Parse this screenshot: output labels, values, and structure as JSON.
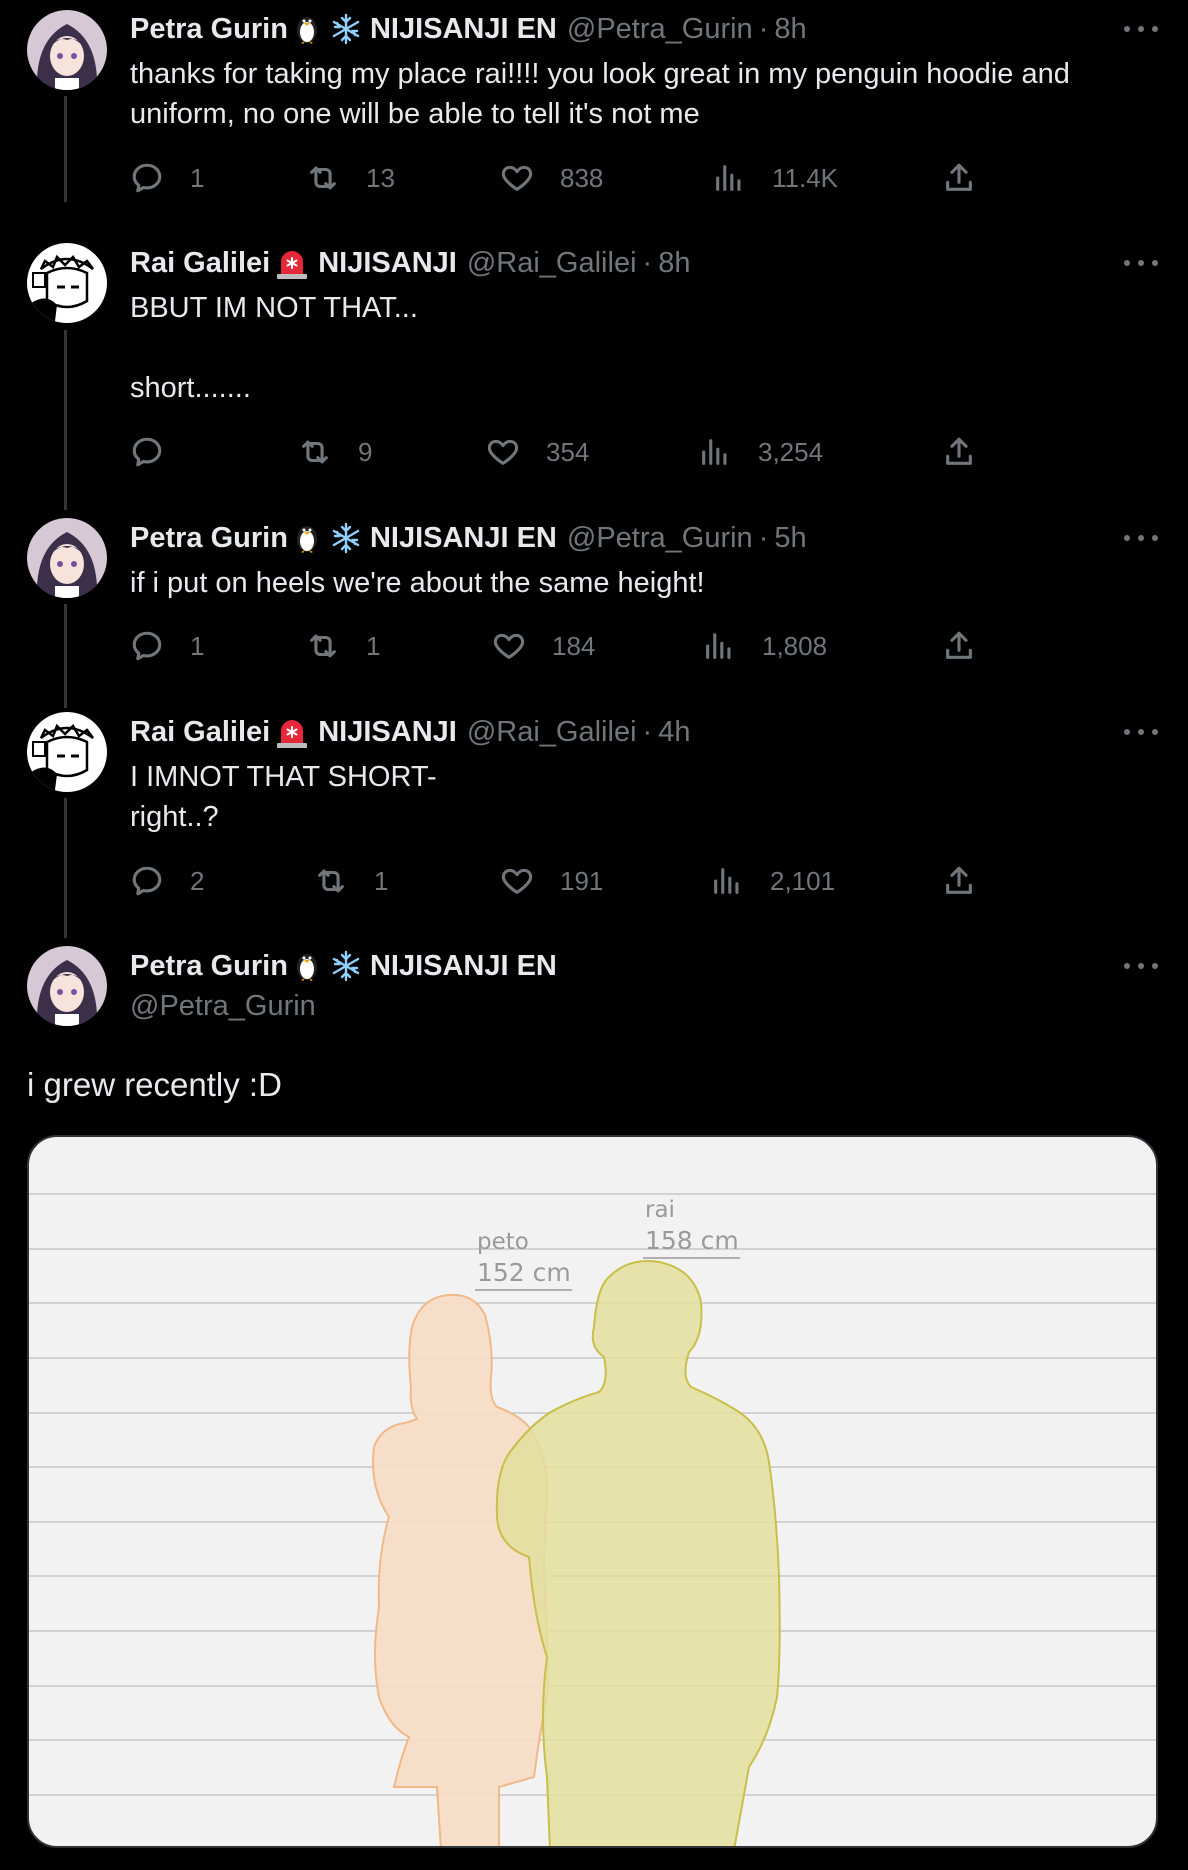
{
  "tweets": [
    {
      "name": "Petra Gurin",
      "org": "NIJISANJI EN",
      "handle": "@Petra_Gurin",
      "time": "8h",
      "text": "thanks for taking my place rai!!!! you look great in my penguin hoodie and\nuniform, no one will be able to tell it's not me",
      "replies": "1",
      "retweets": "13",
      "likes": "838",
      "views": "11.4K"
    },
    {
      "name": "Rai Galilei",
      "org": "NIJISANJI",
      "handle": "@Rai_Galilei",
      "time": "8h",
      "text": "BBUT IM NOT THAT...\n\nshort.......",
      "replies": "",
      "retweets": "9",
      "likes": "354",
      "views": "3,254"
    },
    {
      "name": "Petra Gurin",
      "org": "NIJISANJI EN",
      "handle": "@Petra_Gurin",
      "time": "5h",
      "text": "if i put on heels we're about the same height!",
      "replies": "1",
      "retweets": "1",
      "likes": "184",
      "views": "1,808"
    },
    {
      "name": "Rai Galilei",
      "org": "NIJISANJI",
      "handle": "@Rai_Galilei",
      "time": "4h",
      "text": "I IMNOT THAT SHORT-\nright..?",
      "replies": "2",
      "retweets": "1",
      "likes": "191",
      "views": "2,101"
    }
  ],
  "main_tweet": {
    "name": "Petra Gurin",
    "org": "NIJISANJI EN",
    "handle": "@Petra_Gurin",
    "text": "i grew recently :D",
    "media": {
      "left_label": "peto",
      "left_height": "152 cm",
      "right_label": "rai",
      "right_height": "158 cm"
    }
  },
  "colors": {
    "background": "#000000",
    "text": "#e7e9ea",
    "muted": "#71767b",
    "peto_fill": "#f5dcc5",
    "rai_fill": "#e3df9e"
  }
}
